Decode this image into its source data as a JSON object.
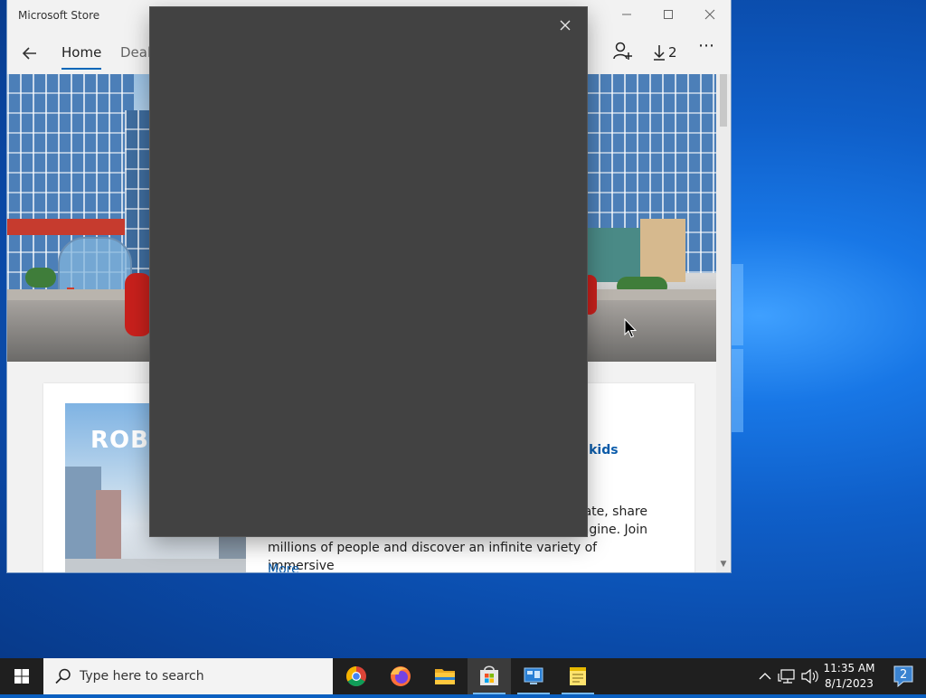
{
  "store": {
    "title": "Microsoft Store",
    "nav": {
      "home_label": "Home",
      "deals_label": "Deals",
      "downloads_count": "2"
    },
    "card": {
      "art_logo_text": "ROB",
      "category_fragment": "y & kids",
      "description_line1": "eate, share",
      "description_line2": "agine. Join",
      "description_line3": "millions of people and discover an infinite variety of immersive",
      "more_label": "More"
    }
  },
  "taskbar": {
    "search_placeholder": "Type here to search",
    "time": "11:35 AM",
    "date": "8/1/2023",
    "notification_count": "2"
  },
  "colors": {
    "accent": "#0067b8",
    "dialog_bg": "#424242",
    "taskbar_bg": "#1f1f1f"
  }
}
